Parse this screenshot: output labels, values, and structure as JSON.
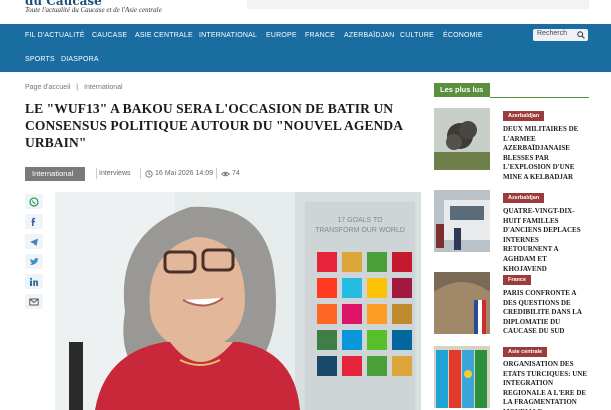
{
  "header": {
    "brand": "du Caucase",
    "tagline": "Toute l'actualité du Caucase et de l'Asie centrale"
  },
  "nav": {
    "items": [
      "FIL D'ACTUALITÉ",
      "CAUCASE",
      "ASIE CENTRALE",
      "INTERNATIONAL",
      "EUROPE",
      "FRANCE",
      "AZERBAÏDJAN",
      "CULTURE",
      "ÉCONOMIE",
      "SPORTS",
      "DIASPORA"
    ],
    "search_label": "Recherch",
    "color": "#1a6da1"
  },
  "breadcrumb": [
    "Page d'accueil",
    "|",
    "International"
  ],
  "article": {
    "title_lines": [
      "LE \"WUF13\" A BAKOU SERA L'OCCASION DE BATIR UN",
      "CONSENSUS POLITIQUE AUTOUR DU \"NOUVEL AGENDA",
      "URBAIN\""
    ],
    "category": "International",
    "author": "Interviews",
    "date": "16 Mai 2026 14:09",
    "views": "74",
    "image_text": "17 GOALS TO TRANSFORM OUR WORLD"
  },
  "share_icons": [
    "whatsapp-icon",
    "facebook-icon",
    "telegram-icon",
    "twitter-icon",
    "linkedin-icon",
    "email-icon"
  ],
  "sidebar": {
    "heading": "Les plus lus",
    "items": [
      {
        "tag": "Azerbaïdjan",
        "title": "DEUX MILITAIRES DE L'ARMEE AZERBAÏDJANAISE BLESSES PAR L'EXPLOSION D'UNE MINE A KELBADJAR",
        "tag_color": "#9b3b3b"
      },
      {
        "tag": "Azerbaïdjan",
        "title": "QUATRE-VINGT-DIX-HUIT FAMILLES D'ANCIENS DEPLACES INTERNES RETOURNENT A AGHDAM ET KHOJAVEND",
        "tag_color": "#9b3b3b"
      },
      {
        "tag": "France",
        "title": "PARIS CONFRONTE A DES QUESTIONS DE CREDIBILITE DANS LA DIPLOMATIE DU CAUCASE DU SUD",
        "tag_color": "#9b3b3b"
      },
      {
        "tag": "Asie centrale",
        "title": "ORGANISATION DES ETATS TURCIQUES: UNE INTEGRATION REGIONALE A L'ERE DE LA FRAGMENTATION MONDIALE",
        "tag_color": "#9b3b3b"
      }
    ]
  }
}
